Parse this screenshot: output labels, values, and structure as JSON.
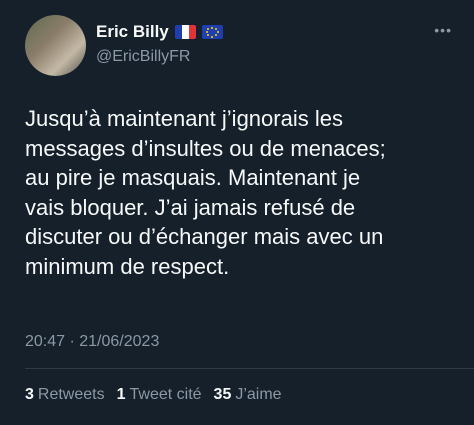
{
  "author": {
    "name": "Eric Billy",
    "handle": "@EricBillyFR",
    "flags": [
      "france-flag-icon",
      "eu-flag-icon"
    ]
  },
  "more_icon": "more-options-icon",
  "tweet": {
    "text": "Jusqu’à maintenant j’ignorais les\nmessages d’insultes ou de menaces;\nau pire je masquais. Maintenant je\nvais bloquer. J’ai jamais refusé de\ndiscuter ou d’échanger mais avec un\nminimum de respect.",
    "timestamp": "20:47 · 21/06/2023"
  },
  "stats": {
    "retweets_count": "3",
    "retweets_label": "Retweets",
    "quotes_count": "1",
    "quotes_label": "Tweet cité",
    "likes_count": "35",
    "likes_label": "J’aime"
  },
  "colors": {
    "background": "#15202b",
    "text": "#f7f9f9",
    "secondary": "#8b98a5"
  }
}
